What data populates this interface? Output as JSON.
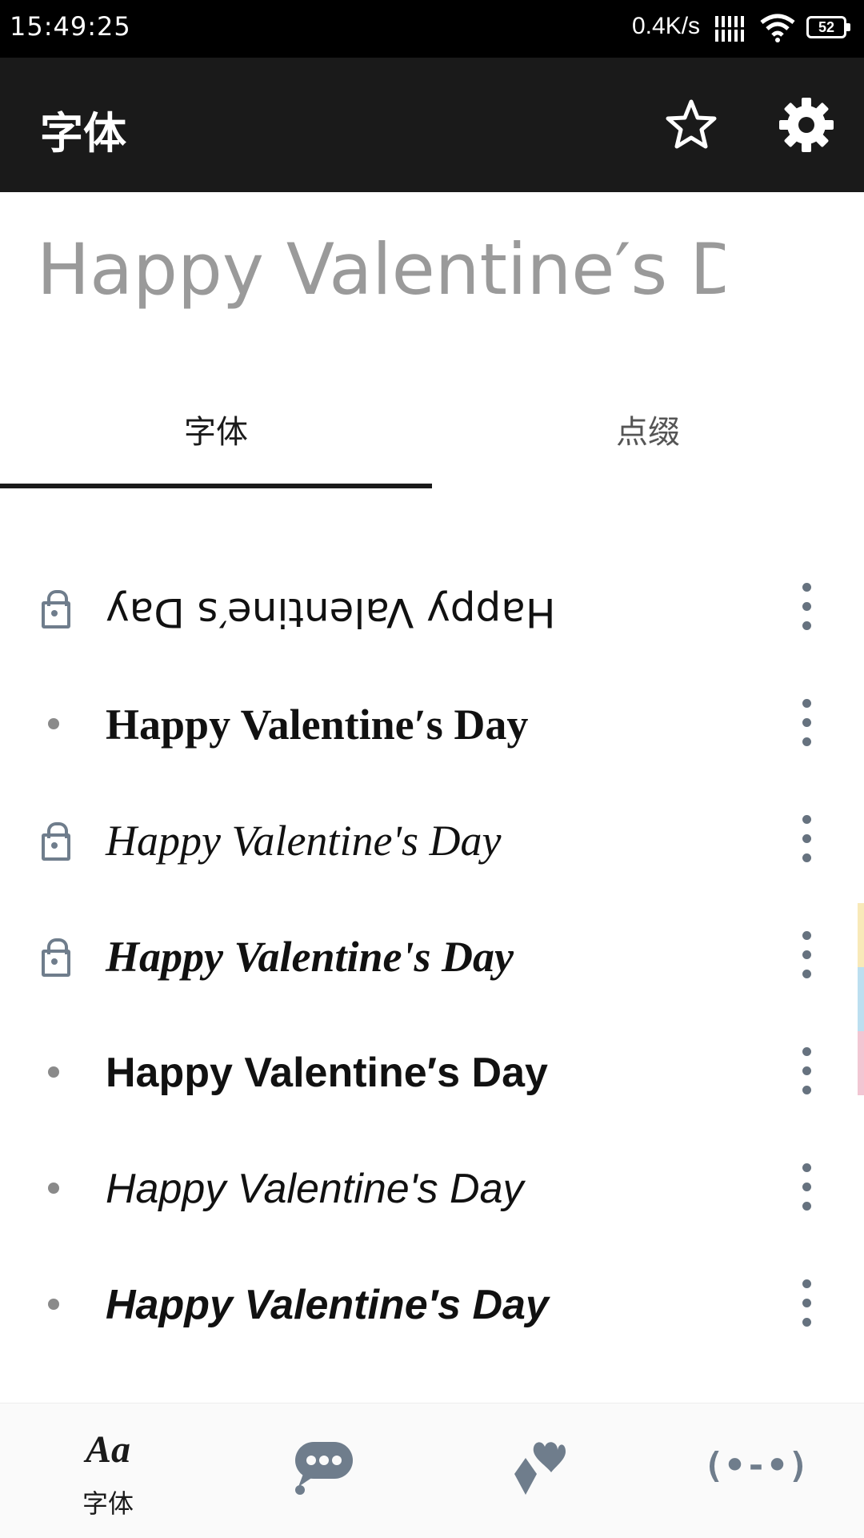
{
  "status_bar": {
    "time": "15:49:25",
    "network_speed": "0.4K/s",
    "battery_level": "52"
  },
  "app_bar": {
    "title": "字体",
    "icons": [
      "star-icon",
      "gear-icon"
    ]
  },
  "preview": {
    "text": "Happy Valentine′s Day"
  },
  "tabs": [
    {
      "label": "字体",
      "selected": true
    },
    {
      "label": "点缀",
      "selected": false
    }
  ],
  "font_list": [
    {
      "sample": "Happy Valentine′s Day",
      "locked": true
    },
    {
      "sample": "Happy Valentine′s Day",
      "locked": false
    },
    {
      "sample": "Happy Valentine's Day",
      "locked": true
    },
    {
      "sample": "Happy Valentine's Day",
      "locked": true
    },
    {
      "sample": "Happy Valentine′s Day",
      "locked": false
    },
    {
      "sample": "Happy Valentine's Day",
      "locked": false
    },
    {
      "sample": "Happy Valentine′s Day",
      "locked": false
    }
  ],
  "bottom_nav": [
    {
      "icon_text": "Aa",
      "label": "字体",
      "icon": "font-aa-icon",
      "selected": true
    },
    {
      "icon": "chat-bubble-icon"
    },
    {
      "icon": "diamond-heart-icon"
    },
    {
      "icon_text": "(•-•)",
      "icon": "emoticon-icon"
    }
  ],
  "colors": {
    "app_bar": "#1a1a1a",
    "icon_gray": "#6f7d8c",
    "preview_text": "#9a9a9a"
  }
}
